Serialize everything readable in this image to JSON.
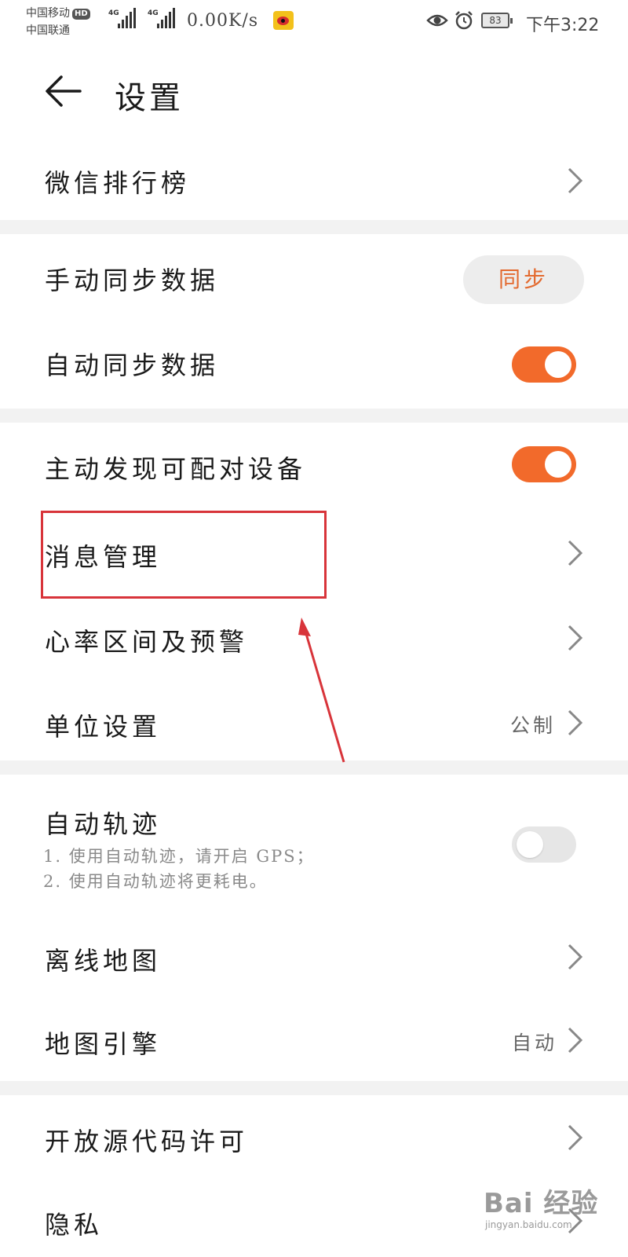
{
  "status_bar": {
    "carrier1": "中国移动",
    "carrier1_badge": "HD",
    "carrier2": "中国联通",
    "network1": "4G",
    "network2": "4G",
    "speed": "0.00K/s",
    "battery": "83",
    "time": "下午3:22"
  },
  "header": {
    "title": "设置"
  },
  "rows": {
    "wechat_rank": "微信排行榜",
    "manual_sync": "手动同步数据",
    "manual_sync_button": "同步",
    "auto_sync": "自动同步数据",
    "auto_sync_on": true,
    "discover": "主动发现可配对设备",
    "discover_on": true,
    "message": "消息管理",
    "heart": "心率区间及预警",
    "unit": "单位设置",
    "unit_value": "公制",
    "track": "自动轨迹",
    "track_note1": "1. 使用自动轨迹，请开启 GPS；",
    "track_note2": "2. 使用自动轨迹将更耗电。",
    "track_on": false,
    "offline_map": "离线地图",
    "map_engine": "地图引擎",
    "map_engine_value": "自动",
    "open_source": "开放源代码许可",
    "privacy": "隐私"
  },
  "watermark": {
    "logo_text": "Bai 经验",
    "url": "jingyan.baidu.com"
  },
  "colors": {
    "accent": "#f26a2b",
    "annotation": "#d8343a"
  }
}
